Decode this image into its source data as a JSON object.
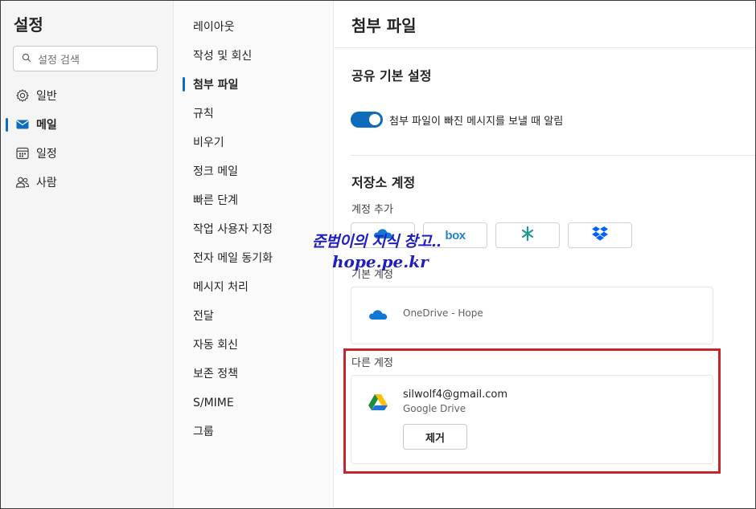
{
  "settings": {
    "title": "설정",
    "search_placeholder": "설정 검색"
  },
  "categories": [
    {
      "label": "일반",
      "icon": "gear-icon"
    },
    {
      "label": "메일",
      "icon": "mail-icon",
      "active": true
    },
    {
      "label": "일정",
      "icon": "calendar-icon"
    },
    {
      "label": "사람",
      "icon": "people-icon"
    }
  ],
  "mail_menu": [
    "레이아웃",
    "작성 및 회신",
    "첨부 파일",
    "규칙",
    "비우기",
    "정크 메일",
    "빠른 단계",
    "작업 사용자 지정",
    "전자 메일 동기화",
    "메시지 처리",
    "전달",
    "자동 회신",
    "보존 정책",
    "S/MIME",
    "그룹"
  ],
  "mail_menu_active": "첨부 파일",
  "content": {
    "page_title": "첨부 파일",
    "sharing_section": "공유 기본 설정",
    "toggle_label": "첨부 파일이 빠진 메시지를 보낼 때 알림",
    "toggle_on": true,
    "storage_section": "저장소 계정",
    "add_account_label": "계정 추가",
    "providers": [
      "onedrive-icon",
      "box-icon",
      "sharefile-icon",
      "dropbox-icon"
    ],
    "box_text": "box",
    "default_account_label": "기본 계정",
    "default_account": {
      "name": "OneDrive - Hope",
      "icon": "onedrive-icon"
    },
    "other_accounts_label": "다른 계정",
    "other_account": {
      "email": "silwolf4@gmail.com",
      "service": "Google Drive",
      "icon": "google-drive-icon",
      "remove_label": "제거"
    }
  },
  "watermark": {
    "line1": "준범이의 지식 창고..",
    "line2": "hope.pe.kr"
  },
  "colors": {
    "accent": "#0f6cbd",
    "highlight_box": "#c1272d",
    "watermark": "#1f1fbf"
  }
}
